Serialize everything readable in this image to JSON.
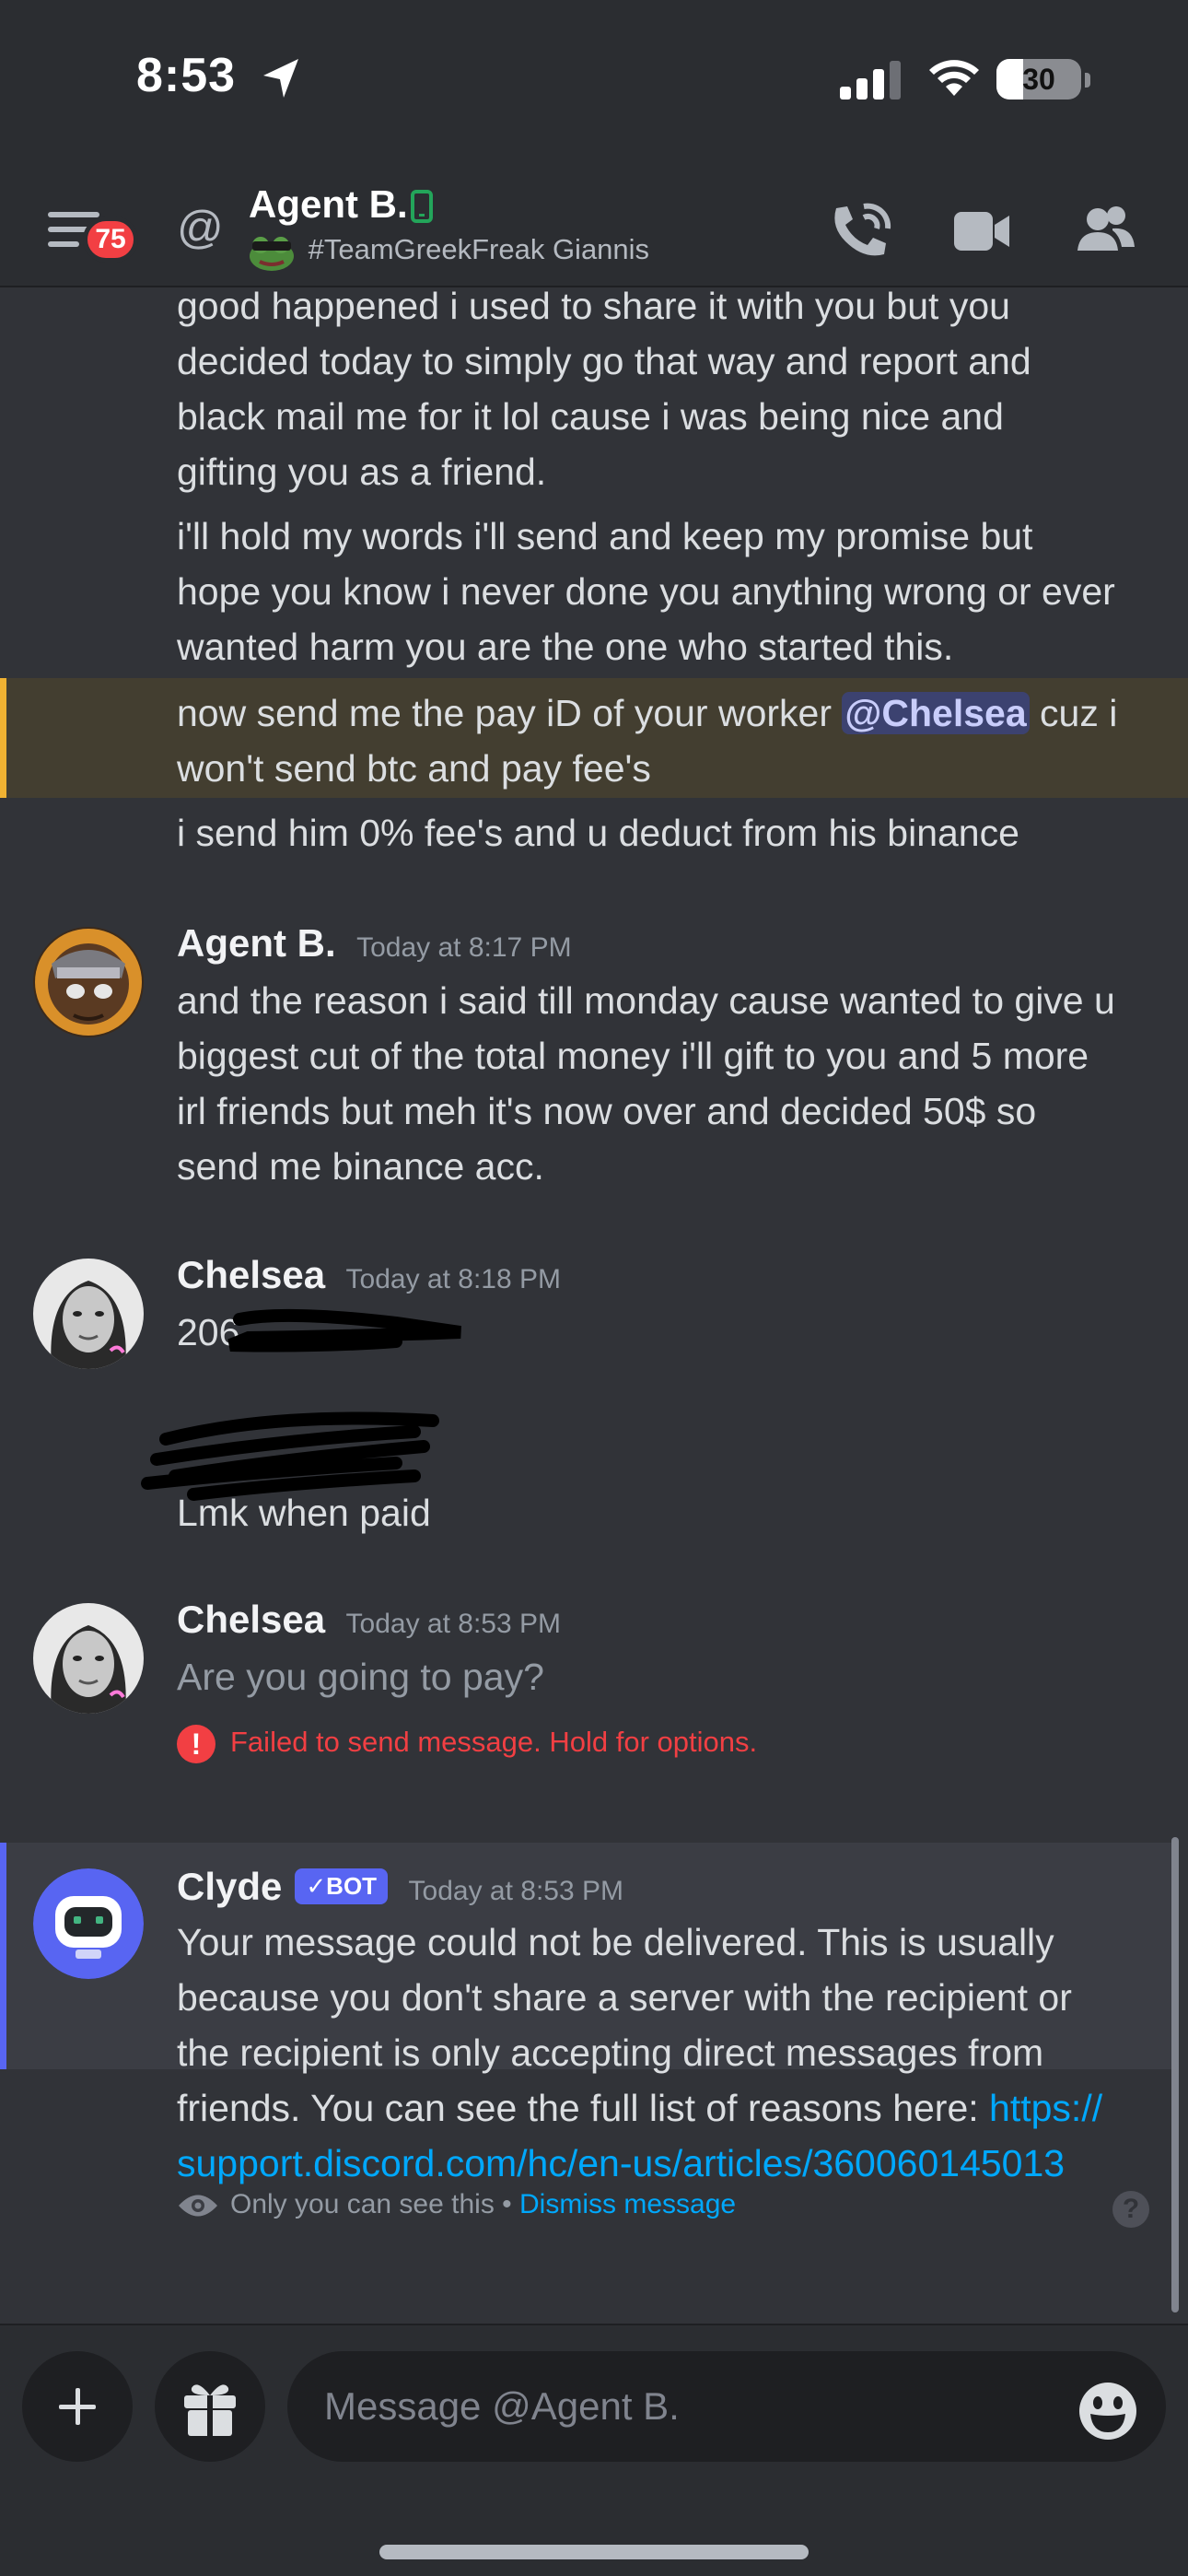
{
  "status_bar": {
    "time": "8:53",
    "battery": "30",
    "battery_level_percent": 30
  },
  "header": {
    "unread_badge": "75",
    "dm_name": "Agent B.",
    "custom_status": "#TeamGreekFreak Giannis",
    "icons": [
      "hamburger-icon",
      "at-icon",
      "mobile-icon",
      "call-icon",
      "video-icon",
      "members-icon"
    ]
  },
  "messages": {
    "cont1": [
      "good happened i used to share it with you but you",
      "decided today to simply go that way and report and",
      "black mail me for it lol cause i was being nice and",
      "gifting you as a friend."
    ],
    "cont2": [
      "i'll hold my words i'll send and keep my promise but",
      "hope you know i never done you anything wrong or ever",
      "wanted harm you are the one who started this."
    ],
    "mention_msg": {
      "before": "now send me the pay iD of your worker ",
      "mention": "@Chelsea",
      "after": " cuz i",
      "line2": "won't send btc and pay fee's"
    },
    "cont3": "i send him 0% fee's and u deduct from his binance",
    "agent_msg": {
      "author": "Agent B.",
      "timestamp": "Today at 8:17 PM",
      "lines": [
        "and the reason i said till monday cause wanted to give u",
        "biggest cut of the total money i'll gift to you and 5 more",
        "irl friends but meh it's now over and decided 50$ so",
        "send me binance acc."
      ]
    },
    "chelsea_msg1": {
      "author": "Chelsea",
      "timestamp": "Today at 8:18 PM",
      "partial": "206",
      "followup": "Lmk when paid"
    },
    "chelsea_msg2": {
      "author": "Chelsea",
      "timestamp": "Today at 8:53 PM",
      "text": "Are you going to pay?",
      "failed": "Failed to send message. Hold for options."
    },
    "clyde_msg": {
      "author": "Clyde",
      "bot_tag": "BOT",
      "timestamp": "Today at 8:53 PM",
      "lines": [
        "Your message could not be delivered. This is usually",
        "because you don't share a server with the recipient or",
        "the recipient is only accepting direct messages from"
      ],
      "line4_text": "friends. You can see the full list of reasons here: ",
      "link_part1": "https://",
      "link_part2": "support.discord.com/hc/en-us/articles/360060145013",
      "only_you": "Only you can see this",
      "separator": " • ",
      "dismiss": "Dismiss message"
    }
  },
  "composer": {
    "placeholder": "Message @Agent B."
  },
  "colors": {
    "background": "#313338",
    "header": "#2b2d31",
    "mention_highlight": "#433e30",
    "mention_bar": "#f0b232",
    "error": "#f23f43",
    "link": "#00a8fc",
    "bot_tag": "#5865f2"
  }
}
